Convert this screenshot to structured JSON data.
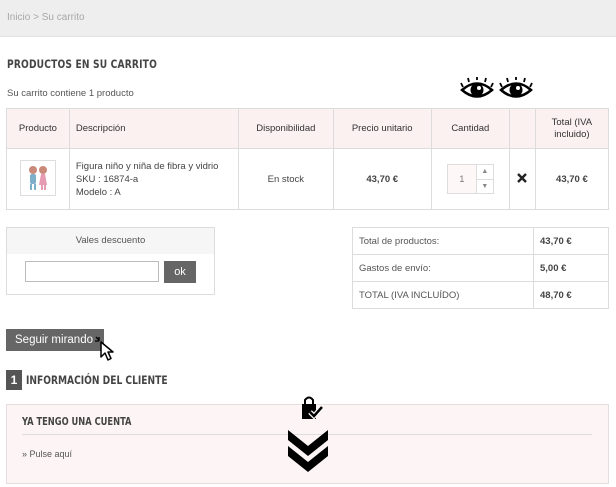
{
  "breadcrumb": {
    "home": "Inicio",
    "separator": ">",
    "current": "Su carrito"
  },
  "cart": {
    "title": "PRODUCTOS EN SU CARRITO",
    "count_text": "Su carrito contiene 1 producto",
    "columns": [
      "Producto",
      "Descripción",
      "Disponibilidad",
      "Precio unitario",
      "Cantidad",
      "",
      "Total (IVA incluido)"
    ],
    "item": {
      "name": "Figura niño y niña de fibra y vidrio",
      "sku": "SKU : 16874-a",
      "model": "Modelo : A",
      "availability": "En stock",
      "unit_price": "43,70 €",
      "quantity": "1",
      "total": "43,70 €"
    }
  },
  "voucher": {
    "title": "Vales descuento",
    "input_value": "",
    "button_label": "ok"
  },
  "totals": [
    {
      "label": "Total de productos:",
      "value": "43,70 €"
    },
    {
      "label": "Gastos de envío:",
      "value": "5,00 €"
    },
    {
      "label": "TOTAL (IVA INCLUÍDO)",
      "value": "48,70 €"
    }
  ],
  "actions": {
    "continue_label": "Seguir mirando"
  },
  "client": {
    "step_number": "1",
    "title": "INFORMACIÓN DEL CLIENTE"
  },
  "account": {
    "title": "YA TENGO UNA CUENTA",
    "link": "» Pulse aquí"
  },
  "icons": {
    "eye": "eye-icon",
    "cursor": "pointer-cursor-icon",
    "bag": "shopping-bag-check-icon",
    "chevrons": "double-chevron-down-icon"
  }
}
